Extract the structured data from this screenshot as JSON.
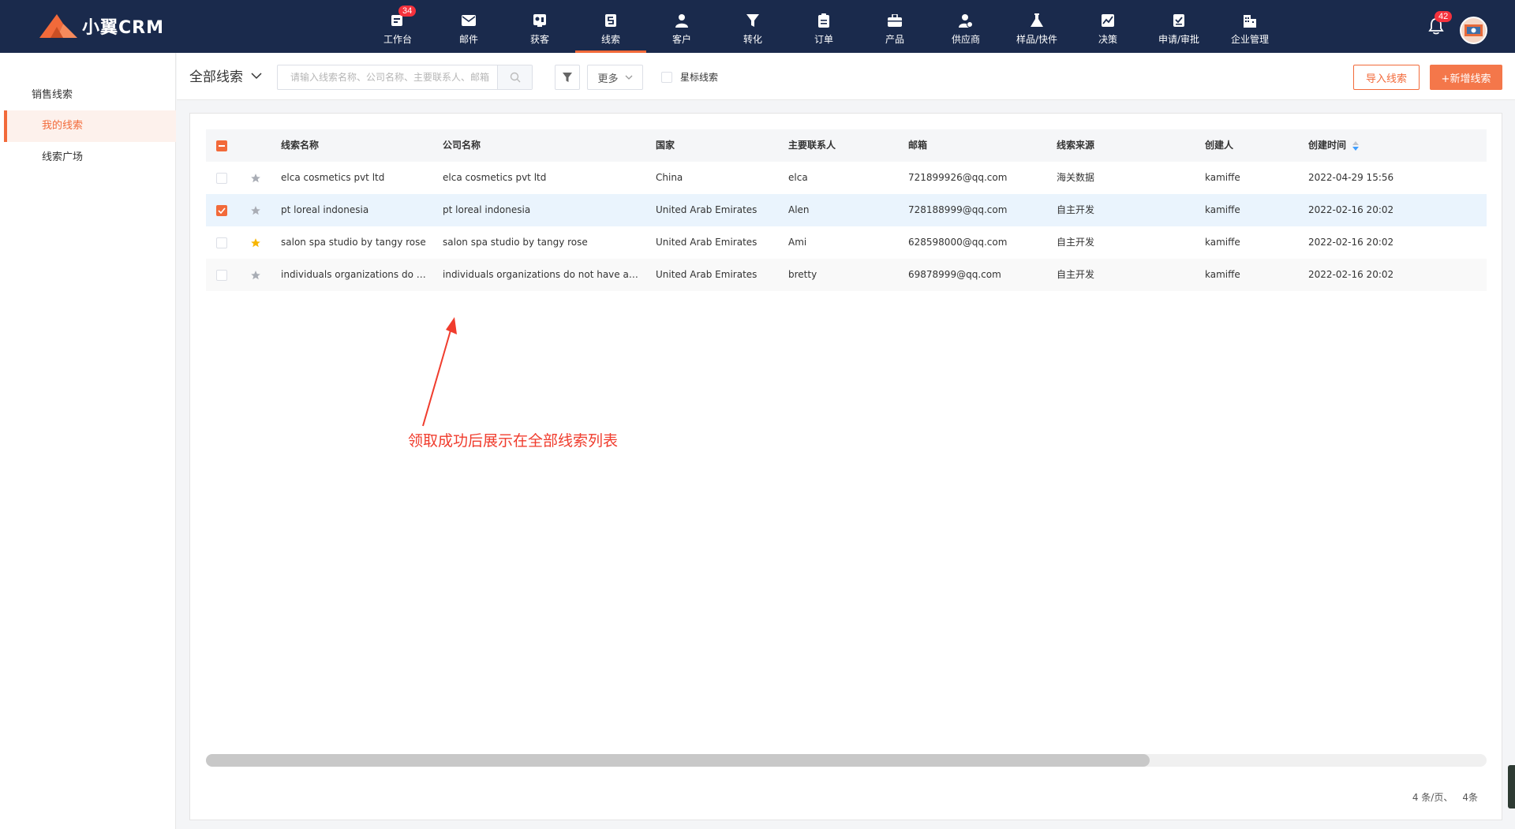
{
  "app": {
    "brand": "小翼CRM",
    "accent": "#f26a3a",
    "nav_bg": "#1a2a4c"
  },
  "nav": [
    {
      "label": "工作台",
      "icon": "dashboard-icon",
      "badge": "34"
    },
    {
      "label": "邮件",
      "icon": "mail-icon"
    },
    {
      "label": "获客",
      "icon": "acquire-icon"
    },
    {
      "label": "线索",
      "icon": "leads-icon",
      "active": true
    },
    {
      "label": "客户",
      "icon": "customer-icon"
    },
    {
      "label": "转化",
      "icon": "funnel-icon"
    },
    {
      "label": "订单",
      "icon": "order-icon"
    },
    {
      "label": "产品",
      "icon": "product-icon"
    },
    {
      "label": "供应商",
      "icon": "supplier-icon"
    },
    {
      "label": "样品/快件",
      "icon": "flask-icon"
    },
    {
      "label": "决策",
      "icon": "chart-icon"
    },
    {
      "label": "申请/审批",
      "icon": "approval-icon"
    },
    {
      "label": "企业管理",
      "icon": "building-icon"
    }
  ],
  "header_right": {
    "notification_badge": "42"
  },
  "sidebar": {
    "heading": "销售线索",
    "items": [
      {
        "label": "我的线索",
        "active": true
      },
      {
        "label": "线索广场"
      }
    ]
  },
  "toolbar": {
    "scope": "全部线索",
    "search_placeholder": "请输入线索名称、公司名称、主要联系人、邮箱",
    "more_label": "更多",
    "star_filter_label": "星标线索",
    "import_label": "导入线索",
    "add_label": "+新增线索"
  },
  "table": {
    "columns": [
      "线索名称",
      "公司名称",
      "国家",
      "主要联系人",
      "邮箱",
      "线索来源",
      "创建人",
      "创建时间"
    ],
    "rows": [
      {
        "name": "elca cosmetics pvt ltd",
        "company": "elca cosmetics pvt ltd",
        "country": "China",
        "contact": "elca",
        "email": "721899926@qq.com",
        "source": "海关数据",
        "creator": "kamiffe",
        "created": "2022-04-29 15:56",
        "checked": false,
        "starred": false
      },
      {
        "name": "pt loreal indonesia",
        "company": "pt loreal indonesia",
        "country": "United Arab Emirates",
        "contact": "Alen",
        "email": "728188999@qq.com",
        "source": "自主开发",
        "creator": "kamiffe",
        "created": "2022-02-16 20:02",
        "checked": true,
        "starred": false
      },
      {
        "name": "salon spa studio by tangy rose",
        "company": "salon spa studio by tangy rose",
        "country": "United Arab Emirates",
        "contact": "Ami",
        "email": "628598000@qq.com",
        "source": "自主开发",
        "creator": "kamiffe",
        "created": "2022-02-16 20:02",
        "checked": false,
        "starred": true
      },
      {
        "name": "individuals organizations do not have a target",
        "company": "individuals organizations do not have a target",
        "country": "United Arab Emirates",
        "contact": "bretty",
        "email": "69878999@qq.com",
        "source": "自主开发",
        "creator": "kamiffe",
        "created": "2022-02-16 20:02",
        "checked": false,
        "starred": false
      }
    ]
  },
  "annotation": "领取成功后展示在全部线索列表",
  "pagination": {
    "per_page": "4 条/页、",
    "total": "4条"
  }
}
